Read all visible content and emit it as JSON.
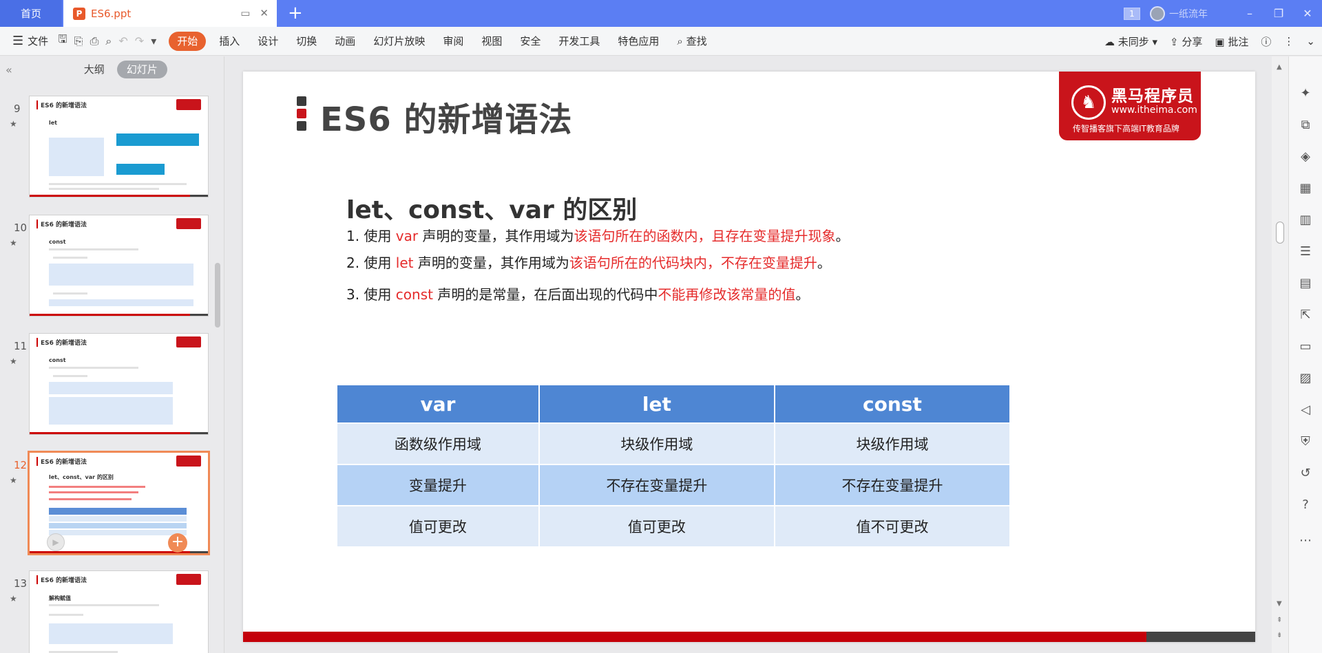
{
  "titlebar": {
    "home_tab": "首页",
    "doc_tab_title": "ES6.ppt",
    "doc_tab_icon": "P",
    "new_tab": "+",
    "window_count": "1",
    "user_name": "一纸流年",
    "minimize": "–",
    "restore": "❐",
    "close": "✕"
  },
  "menubar": {
    "file_label": "文件",
    "tabs": [
      "开始",
      "插入",
      "设计",
      "切换",
      "动画",
      "幻灯片放映",
      "审阅",
      "视图",
      "安全",
      "开发工具",
      "特色应用",
      "查找"
    ],
    "sync_label": "未同步",
    "share_label": "分享",
    "comment_label": "批注"
  },
  "leftpanel": {
    "view_tabs": [
      "大纲",
      "幻灯片"
    ],
    "thumbs": [
      {
        "num": "9",
        "title": "ES6 的新增语法",
        "sub": "let"
      },
      {
        "num": "10",
        "title": "ES6 的新增语法",
        "sub": "const"
      },
      {
        "num": "11",
        "title": "ES6 的新增语法",
        "sub": "const"
      },
      {
        "num": "12",
        "title": "ES6 的新增语法",
        "sub": "let、const、var 的区别"
      },
      {
        "num": "13",
        "title": "ES6 的新增语法",
        "sub": "解构赋值"
      }
    ]
  },
  "slide": {
    "title": "ES6 的新增语法",
    "logo": {
      "name": "黑马程序员",
      "url": "www.itheima.com",
      "slogan": "传智播客旗下高端IT教育品牌"
    },
    "heading": "let、const、var 的区别",
    "points": [
      {
        "prefix": "1. 使用 ",
        "kw": "var",
        "mid": " 声明的变量，其作用域为",
        "hl": "该语句所在的函数内，且存在变量提升现象",
        "end": "。"
      },
      {
        "prefix": "2. 使用 ",
        "kw": "let",
        "mid": " 声明的变量，其作用域为",
        "hl": "该语句所在的代码块内，不存在变量提升",
        "end": "。"
      },
      {
        "prefix": "3. 使用 ",
        "kw": "const",
        "mid": " 声明的是常量，在后面出现的代码中",
        "hl": "不能再修改该常量的值",
        "end": "。"
      }
    ],
    "table": {
      "headers": [
        "var",
        "let",
        "const"
      ],
      "rows": [
        [
          "函数级作用域",
          "块级作用域",
          "块级作用域"
        ],
        [
          "变量提升",
          "不存在变量提升",
          "不存在变量提升"
        ],
        [
          "值可更改",
          "值可更改",
          "值不可更改"
        ]
      ]
    }
  },
  "colors": {
    "accent": "#e8622f",
    "titlebar": "#5b7ef3",
    "brand_red": "#c9141b",
    "table_header": "#4e86d3",
    "highlight": "#e52b2b"
  }
}
